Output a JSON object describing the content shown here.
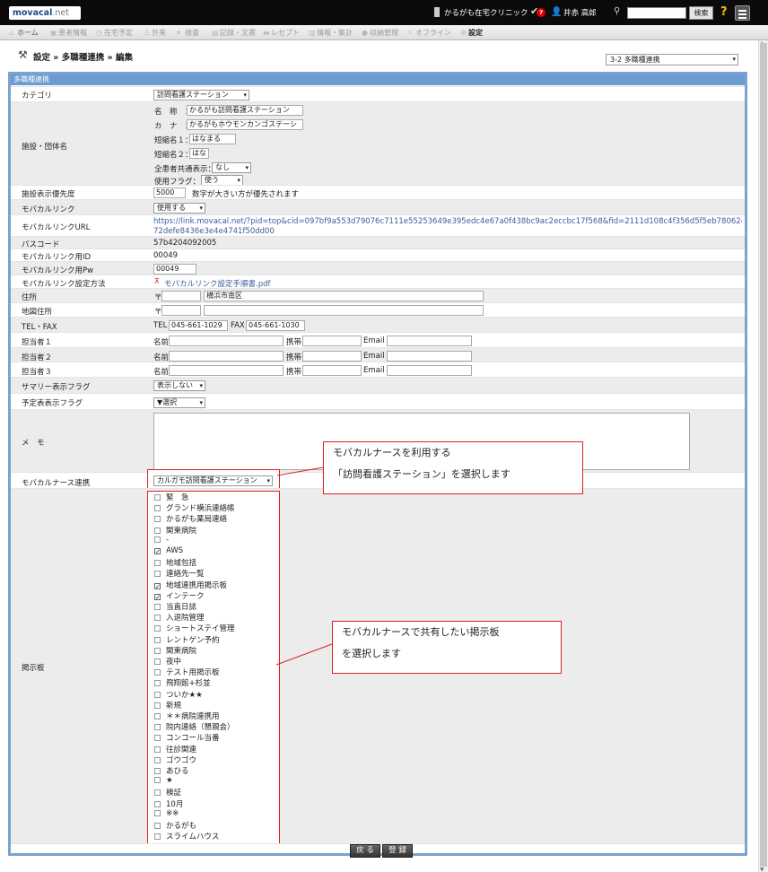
{
  "topbar": {
    "logo_main": "movacal",
    "logo_sub": ".net",
    "clinic_name": "かるがも在宅クリニック",
    "notification_count": "7",
    "user_name": "井赤 高郎",
    "search_button": "検索",
    "search_value": ""
  },
  "nav": {
    "items": [
      "ホーム",
      "患者情報",
      "在宅予定",
      "外来",
      "検査",
      "記録・文書",
      "レセプト",
      "情報・集計",
      "収納管理",
      "オフライン",
      "設定"
    ]
  },
  "page": {
    "title": "設定 » 多職種連携 » 編集",
    "mode_select": "3-2 多職種連携",
    "panel_title": "多職種連携"
  },
  "form": {
    "category": {
      "label": "カテゴリ",
      "value": "訪問看護ステーション"
    },
    "facility": {
      "label": "施設・団体名",
      "name_label": "名　称　：",
      "name_value": "かるがも訪問看護ステーション",
      "kana_label": "カ　ナ　：",
      "kana_value": "かるがもホウモンカンゴステーシ",
      "short1_label": "短縮名１：",
      "short1_value": "はなまる",
      "short2_label": "短縮名２：",
      "short2_value": "はな",
      "common_label": "全患者共通表示：",
      "common_value": "なし",
      "flag_label": "使用フラグ：",
      "flag_value": "使う"
    },
    "priority": {
      "label": "施設表示優先度",
      "value": "5000",
      "note": "数字が大きい方が優先されます"
    },
    "movacal_link": {
      "label": "モバカルリンク",
      "value": "使用する"
    },
    "link_url": {
      "label": "モバカルリンクURL",
      "line1": "https://link.movacal.net/?pid=top&cid=097bf9a553d79076c7111e55253649e395edc4e67a0f438bc9ac2eccbc17f568&fid=2111d108c4f356d5f5eb7806241b60af333801",
      "line2": "72defe8436e3e4e4741f50dd00"
    },
    "passcode": {
      "label": "パスコード",
      "value": "57b4204092005"
    },
    "link_id": {
      "label": "モバカルリンク用ID",
      "value": "00049"
    },
    "link_pw": {
      "label": "モバカルリンク用Pw",
      "value": "00049"
    },
    "link_method": {
      "label": "モバカルリンク設定方法",
      "value": "モバカルリンク設定手順書.pdf"
    },
    "address": {
      "label": "住所",
      "zip_mark": "〒",
      "zip": "",
      "value": "横浜市南区"
    },
    "map_address": {
      "label": "地図住所",
      "zip_mark": "〒",
      "zip": "",
      "value": ""
    },
    "telfax": {
      "label": "TEL・FAX",
      "tel_label": "TEL",
      "tel": "045-661-1029",
      "fax_label": "FAX",
      "fax": "045-661-1030"
    },
    "contacts": [
      {
        "label": "担当者１",
        "name_label": "名前",
        "mobile_label": "携帯",
        "email_label": "Email"
      },
      {
        "label": "担当者２",
        "name_label": "名前",
        "mobile_label": "携帯",
        "email_label": "Email"
      },
      {
        "label": "担当者３",
        "name_label": "名前",
        "mobile_label": "携帯",
        "email_label": "Email"
      }
    ],
    "summary_flag": {
      "label": "サマリー表示フラグ",
      "value": "表示しない"
    },
    "schedule_flag": {
      "label": "予定表表示フラグ",
      "value": "▼選択"
    },
    "memo": {
      "label": "メ　モ",
      "value": ""
    },
    "nurse_link": {
      "label": "モバカルナース連携",
      "value": "カルガモ訪問看護ステーション"
    },
    "board": {
      "label": "掲示板"
    }
  },
  "boards": [
    {
      "label": "緊　急",
      "checked": false
    },
    {
      "label": "グランド横浜連絡帳",
      "checked": false
    },
    {
      "label": "かるがも薬局連絡",
      "checked": false
    },
    {
      "label": "関東病院",
      "checked": false
    },
    {
      "label": "-",
      "checked": false
    },
    {
      "label": "AWS",
      "checked": true
    },
    {
      "label": "地域包括",
      "checked": false
    },
    {
      "label": "連絡先一覧",
      "checked": false
    },
    {
      "label": "地域連携用掲示板",
      "checked": true
    },
    {
      "label": "インテーク",
      "checked": true
    },
    {
      "label": "当直日誌",
      "checked": false
    },
    {
      "label": "入退院管理",
      "checked": false
    },
    {
      "label": "ショートステイ管理",
      "checked": false
    },
    {
      "label": "レントゲン予約",
      "checked": false
    },
    {
      "label": "関東病院",
      "checked": false
    },
    {
      "label": "夜中",
      "checked": false
    },
    {
      "label": "テスト用掲示板",
      "checked": false
    },
    {
      "label": "飛翔館+杉並",
      "checked": false
    },
    {
      "label": "ついか★★",
      "checked": false
    },
    {
      "label": "新規",
      "checked": false
    },
    {
      "label": "＊＊病院連携用",
      "checked": false
    },
    {
      "label": "院内連絡（懇親会）",
      "checked": false
    },
    {
      "label": "コンコール当番",
      "checked": false
    },
    {
      "label": "往診関連",
      "checked": false
    },
    {
      "label": "ゴウゴウ",
      "checked": false
    },
    {
      "label": "あひる",
      "checked": false
    },
    {
      "label": "★",
      "checked": false
    },
    {
      "label": "検証",
      "checked": false
    },
    {
      "label": "10月",
      "checked": false
    },
    {
      "label": "※※",
      "checked": false
    },
    {
      "label": "かるがも",
      "checked": false
    },
    {
      "label": "スライムハウス",
      "checked": false
    }
  ],
  "callouts": {
    "nurse_line1": "モバカルナースを利用する",
    "nurse_line2": "「訪問看護ステーション」を選択します",
    "board_line1": "モバカルナースで共有したい掲示板",
    "board_line2": "を選択します"
  },
  "buttons": {
    "back": "戻 る",
    "register": "登 録"
  },
  "colors": {
    "topbar": "#0b0b0b",
    "panel_border": "#7aa3cf",
    "panel_header": "#6b9bd1",
    "callout_border": "#dd2222",
    "link": "#3a5d9c"
  }
}
